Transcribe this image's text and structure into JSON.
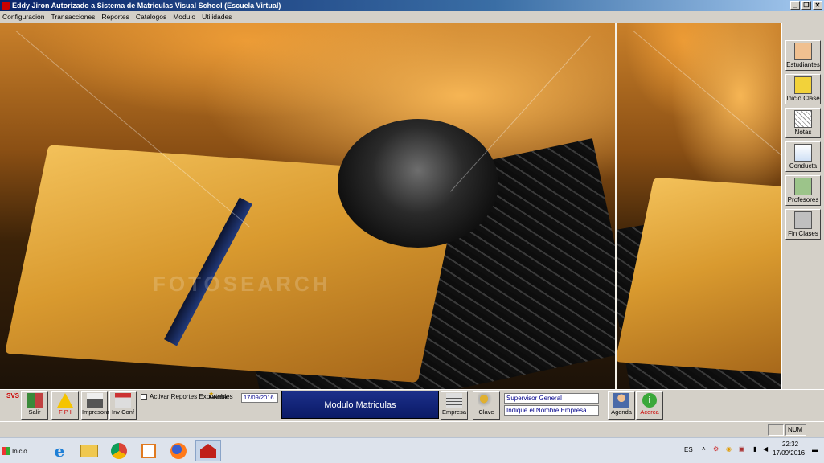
{
  "window": {
    "title": "Eddy Jiron   Autorizado a Sistema de Matriculas Visual School (Escuela Virtual)",
    "controls": {
      "minimize": "_",
      "restore": "❐",
      "close": "✕"
    }
  },
  "menu": [
    "Configuracion",
    "Transacciones",
    "Reportes",
    "Catalogos",
    "Modulo",
    "Utilidades"
  ],
  "watermark": "FOTOSEARCH",
  "right_toolbar": [
    {
      "label": "Estudiantes",
      "icon": "student-icon"
    },
    {
      "label": "Inicio Clase",
      "icon": "bus-icon"
    },
    {
      "label": "Notas",
      "icon": "grades-icon"
    },
    {
      "label": "Conducta",
      "icon": "conduct-icon"
    },
    {
      "label": "Profesores",
      "icon": "teacher-icon"
    },
    {
      "label": "Fin Clases",
      "icon": "end-class-icon"
    }
  ],
  "bottom_toolbar": {
    "svs": "SVS",
    "salir": "Salir",
    "fpi": "F P I",
    "impresora": "Impresora",
    "inv_conf": "Inv Conf",
    "activar_reportes": "Activar Reportes Exportables",
    "fecha_label": "Fecha",
    "fecha_value": "17/09/2016",
    "modulo": "Modulo Matriculas",
    "empresa": "Empresa",
    "clave": "Clave",
    "supervisor": "Supervisor General",
    "empresa_nombre": "Indique el Nombre Empresa",
    "agenda": "Agenda",
    "acerca": "Acerca"
  },
  "statusbar": {
    "num": "NUM"
  },
  "taskbar": {
    "start": "Inicio",
    "lang": "ES",
    "time": "22:32",
    "date": "17/09/2016"
  },
  "colors": {
    "title_bar": "#0a246a",
    "modulo_bg": "#1c2f8a",
    "accent_red": "#cc0000"
  }
}
